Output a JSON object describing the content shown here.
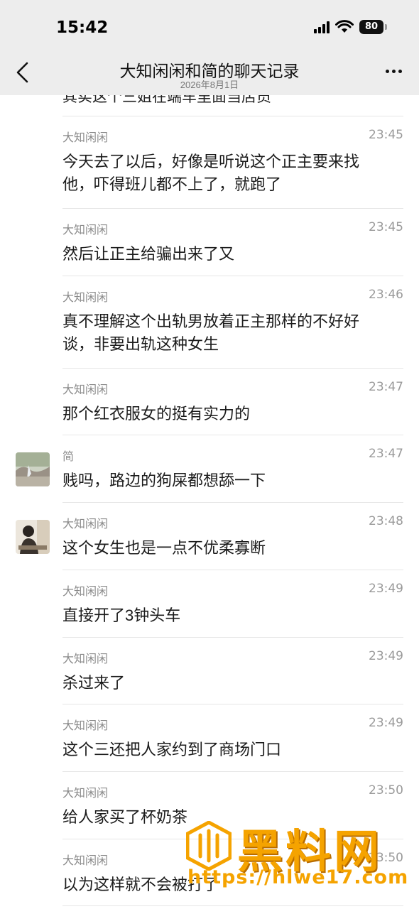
{
  "status_bar": {
    "time": "15:42",
    "battery": "80"
  },
  "nav": {
    "title": "大知闲闲和简的聊天记录",
    "subtitle": "2026年8月1日"
  },
  "partial_message": {
    "text": "其实这个三姐在端车里面当店员"
  },
  "messages": [
    {
      "sender": "大知闲闲",
      "time": "23:45",
      "text": "今天去了以后，好像是听说这个正主要来找他，吓得班儿都不上了，就跑了",
      "avatar": ""
    },
    {
      "sender": "大知闲闲",
      "time": "23:45",
      "text": "然后让正主给骗出来了又",
      "avatar": ""
    },
    {
      "sender": "大知闲闲",
      "time": "23:46",
      "text": "真不理解这个出轨男放着正主那样的不好好谈，非要出轨这种女生",
      "avatar": ""
    },
    {
      "sender": "大知闲闲",
      "time": "23:47",
      "text": "那个红衣服女的挺有实力的",
      "avatar": ""
    },
    {
      "sender": "简",
      "time": "23:47",
      "text": "贱吗，路边的狗屎都想舔一下",
      "avatar": "landscape-avatar"
    },
    {
      "sender": "大知闲闲",
      "time": "23:48",
      "text": "这个女生也是一点不优柔寡断",
      "avatar": "person-avatar"
    },
    {
      "sender": "大知闲闲",
      "time": "23:49",
      "text": "直接开了3钟头车",
      "avatar": ""
    },
    {
      "sender": "大知闲闲",
      "time": "23:49",
      "text": "杀过来了",
      "avatar": ""
    },
    {
      "sender": "大知闲闲",
      "time": "23:49",
      "text": "这个三还把人家约到了商场门口",
      "avatar": ""
    },
    {
      "sender": "大知闲闲",
      "time": "23:50",
      "text": "给人家买了杯奶茶",
      "avatar": ""
    },
    {
      "sender": "大知闲闲",
      "time": "23:50",
      "text": "以为这样就不会被打了",
      "avatar": ""
    }
  ],
  "watermark": {
    "title": "黑料网",
    "url": "https://hlwe17.com"
  },
  "colors": {
    "header_bg": "#ededed",
    "divider": "#e6e6e6",
    "watermark": "#f5a300"
  }
}
